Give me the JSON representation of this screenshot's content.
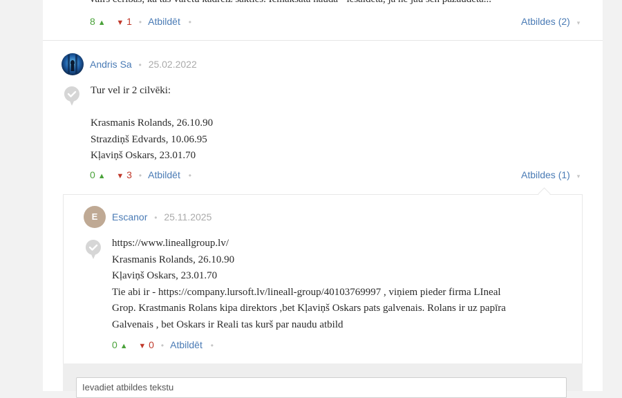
{
  "top_comment": {
    "text_fragment": "vairs cerības, ka tas varētu kādreiz sakties. Iemaksātā nauda - iesaldēta, ja ne jau sen pazaudēta...",
    "up": "8",
    "down": "1",
    "reply_label": "Atbildēt",
    "replies_label": "Atbildes (2)"
  },
  "comment": {
    "author": "Andris Sa",
    "date": "25.02.2022",
    "lines": [
      "Tur vel ir 2 cilvēki:",
      "",
      "Krasmanis Rolands, 26.10.90",
      "Strazdiņš Edvards, 10.06.95",
      "Kļaviņš Oskars, 23.01.70"
    ],
    "up": "0",
    "down": "3",
    "reply_label": "Atbildēt",
    "replies_label": "Atbildes (1)"
  },
  "reply": {
    "avatar_letter": "E",
    "author": "Escanor",
    "date": "25.11.2025",
    "lines": [
      "https://www.lineallgroup.lv/",
      "Krasmanis Rolands, 26.10.90",
      "Kļaviņš Oskars, 23.01.70",
      "Tie abi ir - https://company.lursoft.lv/lineall-group/40103769997 , viņiem pieder firma LIneal",
      "Grop. Krastmanis Rolans kipa direktors ,bet Kļaviņš Oskars pats galvenais. Rolans ir uz papīra",
      "Galvenais , bet Oskars ir Reali tas kurš par naudu atbild"
    ],
    "up": "0",
    "down": "0",
    "reply_label": "Atbildēt"
  },
  "reply_input": {
    "placeholder": "Ievadiet atbildes tekstu"
  },
  "colors": {
    "up": "#4aa23a",
    "down": "#c0392b",
    "link": "#4a7bb5",
    "avatar_letter_bg": "#bfa994"
  },
  "icons": [
    "arrow-up-icon",
    "arrow-down-icon",
    "chevron-down-icon",
    "check-badge-icon"
  ]
}
